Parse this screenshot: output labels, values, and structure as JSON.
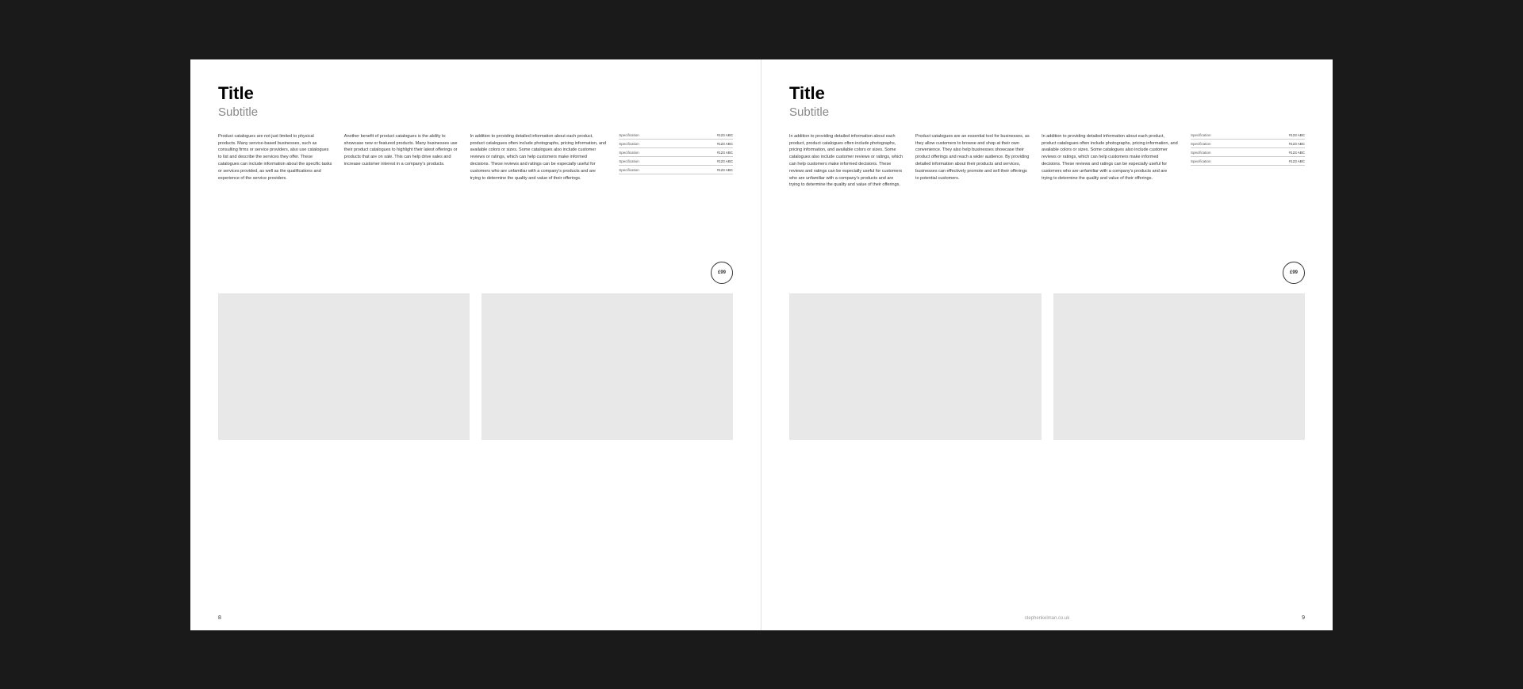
{
  "left_page": {
    "title": "Title",
    "subtitle": "Subtitle",
    "page_number": "8",
    "col1_text": "Product catalogues are not just limited to physical products. Many service-based businesses, such as consulting firms or service providers, also use catalogues to list and describe the services they offer. These catalogues can include information about the specific tasks or services provided, as well as the qualifications and experience of the service providers.",
    "col2_text": "Another benefit of product catalogues is the ability to showcase new or featured products. Many businesses use their product catalogues to highlight their latest offerings or products that are on sale. This can help drive sales and increase customer interest in a company's products.",
    "col3_text": "In addition to providing detailed information about each product, product catalogues often include photographs, pricing information, and available colors or sizes. Some catalogues also include customer reviews or ratings, which can help customers make informed decisions. These reviews and ratings can be especially useful for customers who are unfamiliar with a company's products and are trying to determine the quality and value of their offerings.",
    "specs": [
      {
        "label": "Specification",
        "value": "#123 ABC"
      },
      {
        "label": "Specification",
        "value": "#123 ABC"
      },
      {
        "label": "Specification",
        "value": "#123 ABC"
      },
      {
        "label": "Specification",
        "value": "#123 ABC"
      },
      {
        "label": "Specification",
        "value": "#123 ABC"
      }
    ],
    "price": "£99"
  },
  "right_page": {
    "title": "Title",
    "subtitle": "Subtitle",
    "page_number": "9",
    "website": "stephenkelman.co.uk",
    "col1_text": "In addition to providing detailed information about each product, product catalogues often include photographs, pricing information, and available colors or sizes. Some catalogues also include customer reviews or ratings, which can help customers make informed decisions. These reviews and ratings can be especially useful for customers who are unfamiliar with a company's products and are trying to determine the quality and value of their offerings.",
    "col2_text": "Product catalogues are an essential tool for businesses, as they allow customers to browse and shop at their own convenience. They also help businesses showcase their product offerings and reach a wider audience. By providing detailed information about their products and services, businesses can effectively promote and sell their offerings to potential customers.",
    "col3_text": "In addition to providing detailed information about each product, product catalogues often include photographs, pricing information, and available colors or sizes. Some catalogues also include customer reviews or ratings, which can help customers make informed decisions. These reviews and ratings can be especially useful for customers who are unfamiliar with a company's products and are trying to determine the quality and value of their offerings.",
    "specs": [
      {
        "label": "Specification",
        "value": "#123 ABC"
      },
      {
        "label": "Specification",
        "value": "#123 ABC"
      },
      {
        "label": "Specification",
        "value": "#123 ABC"
      },
      {
        "label": "Specification",
        "value": "#123 ABC"
      }
    ],
    "price": "£99"
  }
}
